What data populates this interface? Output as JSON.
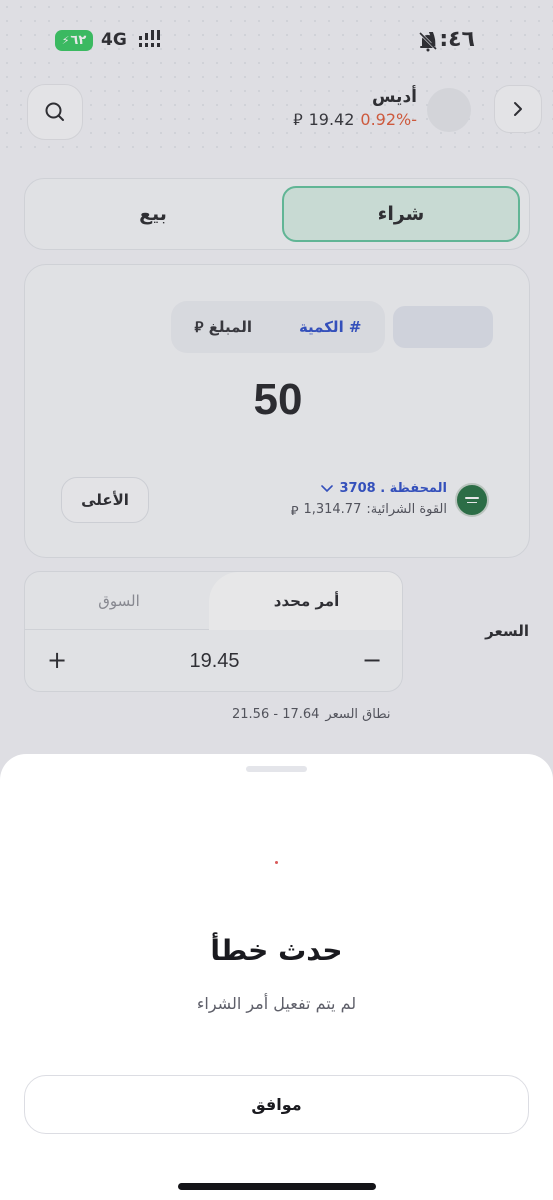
{
  "status_bar": {
    "time": "١:٤٦",
    "battery": "٦٢",
    "network": "4G"
  },
  "header": {
    "stock_name": "أديس",
    "stock_price": "19.42",
    "stock_change": "-0.92%",
    "currency_symbol": "⃁"
  },
  "trade_tabs": {
    "buy_label": "شراء",
    "sell_label": "بيع",
    "active": "buy",
    "buy_color": "#5cc39a"
  },
  "order_card": {
    "quantity_label": "# الكمية",
    "amount_label": "المبلغ",
    "amount_value": "50",
    "max_label": "الأعلى",
    "portfolio_label": "المحفظة . 3708",
    "buying_power_label": "القوة الشرائية:",
    "buying_power_value": "1,314.77"
  },
  "price_section": {
    "price_label": "السعر",
    "limit_order_label": "أمر محدد",
    "market_order_label": "السوق",
    "price_value": "19.45",
    "plus": "+",
    "minus": "−",
    "range_label": "نطاق السعر",
    "range_value": "17.64 - 21.56"
  },
  "error_sheet": {
    "title": "حدث خطأ",
    "message": "لم يتم تفعيل أمر الشراء",
    "ok_label": "موافق"
  },
  "colors": {
    "accent_blue": "#2547c8",
    "negative": "#e0522f"
  }
}
